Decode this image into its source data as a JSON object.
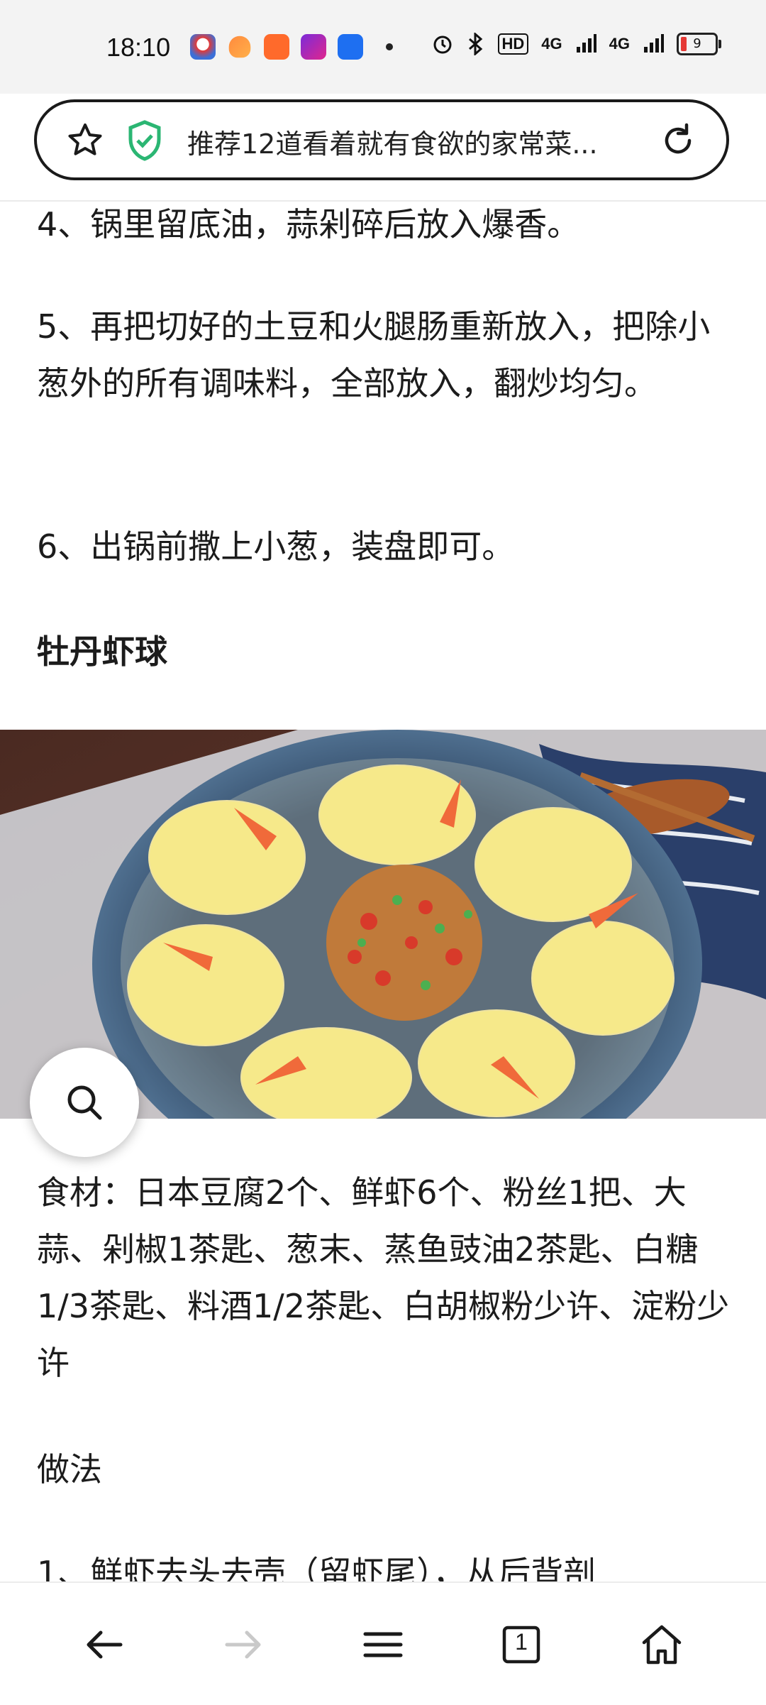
{
  "status_bar": {
    "time": "18:10",
    "network_type_1": "4G",
    "network_type_2": "4G",
    "hd_label": "HD",
    "battery_level": "9"
  },
  "address_bar": {
    "page_title": "推荐12道看着就有食欲的家常菜..."
  },
  "article": {
    "step4": "4、锅里留底油，蒜剁碎后放入爆香。",
    "step5": "5、再把切好的土豆和火腿肠重新放入，把除小葱外的所有调味料，全部放入，翻炒均匀。",
    "step6": "6、出锅前撒上小葱，装盘即可。",
    "dish_title": "牡丹虾球",
    "ingredients": "食材：日本豆腐2个、鲜虾6个、粉丝1把、大蒜、剁椒1茶匙、葱末、蒸鱼豉油2茶匙、白糖1/3茶匙、料酒1/2茶匙、白胡椒粉少许、淀粉少许",
    "method_heading": "做法",
    "step1_partial": "1、鲜虾去头去壳（留虾尾），从后背剖"
  },
  "bottom_nav": {
    "tab_count": "1"
  },
  "colors": {
    "status_bar_bg": "#f3f3f3",
    "shield_green": "#2bb673",
    "text": "#1c1c1c",
    "disabled_icon": "#c9c9c9"
  },
  "icons": [
    "star-icon",
    "security-shield-icon",
    "reload-icon",
    "search-icon",
    "back-icon",
    "forward-icon",
    "menu-icon",
    "tabs-icon",
    "home-icon"
  ]
}
